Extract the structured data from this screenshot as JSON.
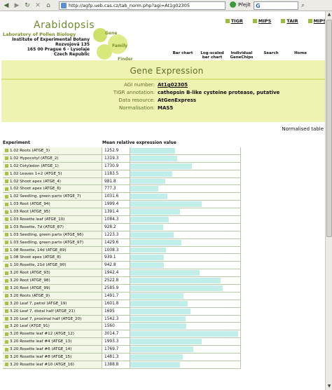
{
  "browser": {
    "url": "http://agfp.ueb.cas.cz/tab_norm.php?agi=At1g02305",
    "go_label": "Přejít",
    "search_engine": "G"
  },
  "site": {
    "title": "Arabidopsis",
    "lab_lines": [
      "Laboratory of Pollen Biology",
      "Institute of Experimental Botany",
      "Rozvojová 135",
      "165 00 Prague 6 - Lysolaje",
      "Czech Republic"
    ],
    "logo_words": [
      "Gene",
      "Family",
      "Finder"
    ],
    "ext_links": [
      "TIGR",
      "MIPS",
      "TAIR",
      "MIPS"
    ],
    "nav_tabs": [
      "Bar chart",
      "Log-scaled bar chart",
      "Individual GeneChips",
      "Search",
      "Home"
    ]
  },
  "page": {
    "title": "Gene Expression",
    "agi_label": "AGI number:",
    "agi_value": "At1g02305",
    "tigr_label": "TIGR annotation:",
    "tigr_value": "cathepsin B-like cysteine protease, putative",
    "resource_label": "Data resource:",
    "resource_value": "AtGenExpress",
    "normalisation_label": "Normalisation:",
    "normalisation_value": "MAS5",
    "table_mode": "Normalised table"
  },
  "table": {
    "col_experiment": "Experiment",
    "col_value": "Mean relative expression value",
    "bar_scale_max": 3100,
    "rows": [
      {
        "name": "1.02 Roots (ATGE_3)",
        "value": "1252.9"
      },
      {
        "name": "1.02 Hypocotyl (ATGE_2)",
        "value": "1319.3"
      },
      {
        "name": "1.02 Cotyledon (ATGE_1)",
        "value": "1730.9"
      },
      {
        "name": "1.02 Leaves 1+2 (ATGE_5)",
        "value": "1183.5"
      },
      {
        "name": "1.02 Shoot apex (ATGE_4)",
        "value": "981.8"
      },
      {
        "name": "1.02 Shoot apex (ATGE_6)",
        "value": "777.3"
      },
      {
        "name": "1.02 Seedling, green parts (ATGE_7)",
        "value": "1031.6"
      },
      {
        "name": "1.03 Root (ATGE_94)",
        "value": "1999.4"
      },
      {
        "name": "1.03 Root (ATGE_95)",
        "value": "1391.4"
      },
      {
        "name": "1.03 Rosette leaf (ATGE_10)",
        "value": "1084.3"
      },
      {
        "name": "1.03 Rosette, 7d (ATGE_87)",
        "value": "928.2"
      },
      {
        "name": "1.03 Seedling, green parts (ATGE_96)",
        "value": "1223.3"
      },
      {
        "name": "1.03 Seedling, green parts (ATGE_97)",
        "value": "1429.6"
      },
      {
        "name": "1.08 Rosette, 14d (ATGE_89)",
        "value": "1008.3"
      },
      {
        "name": "1.08 Shoot apex (ATGE_8)",
        "value": "939.1"
      },
      {
        "name": "1.10 Rosette, 21d (ATGE_90)",
        "value": "942.8"
      },
      {
        "name": "3.20 Root (ATGE_93)",
        "value": "1942.4"
      },
      {
        "name": "3.20 Root (ATGE_98)",
        "value": "2522.8"
      },
      {
        "name": "3.20 Root (ATGE_99)",
        "value": "2585.9"
      },
      {
        "name": "3.20 Roots (ATGE_9)",
        "value": "1491.7"
      },
      {
        "name": "3.20 Leaf 7, petiol (ATGE_19)",
        "value": "1601.8"
      },
      {
        "name": "3.20 Leaf 7, distal half (ATGE_21)",
        "value": "1695"
      },
      {
        "name": "3.20 Leaf 7, proximal half (ATGE_20)",
        "value": "1542.3"
      },
      {
        "name": "3.20 Leaf (ATGE_91)",
        "value": "1560"
      },
      {
        "name": "3.20 Rosette leaf #12 (ATGE_12)",
        "value": "3014.7"
      },
      {
        "name": "3.20 Rosette leaf #4 (ATGE_13)",
        "value": "1993.3"
      },
      {
        "name": "3.20 Rosette leaf #6 (ATGE_14)",
        "value": "1769.7"
      },
      {
        "name": "3.20 Rosette leaf #8 (ATGE_15)",
        "value": "1481.3"
      },
      {
        "name": "3.20 Rosette leaf #10 (ATGE_16)",
        "value": "1388.8"
      }
    ]
  }
}
